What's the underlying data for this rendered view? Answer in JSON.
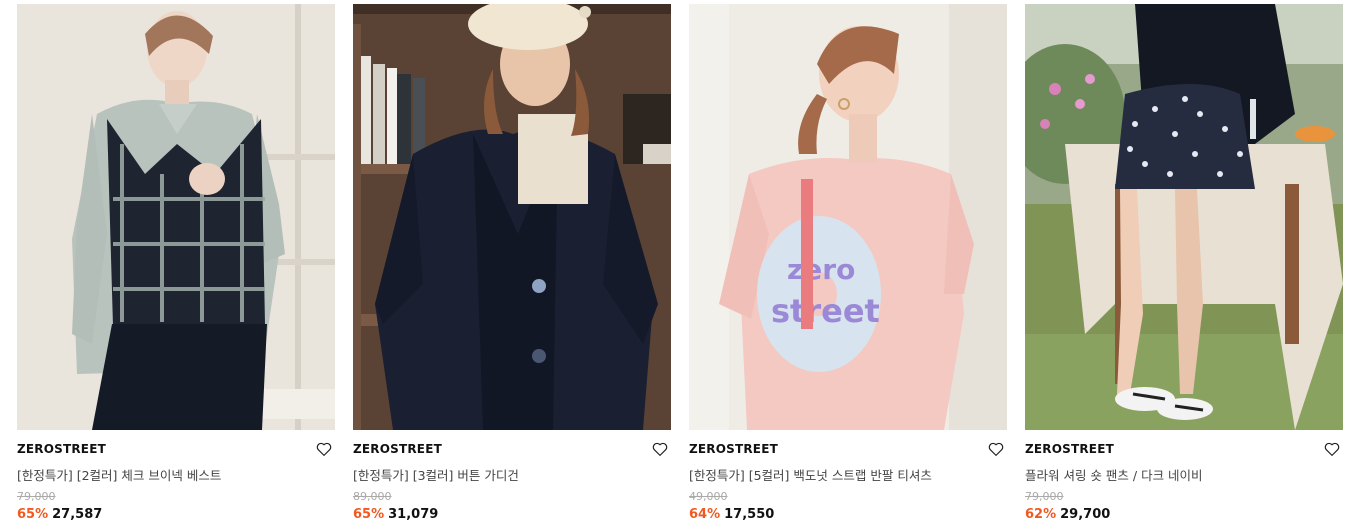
{
  "products": [
    {
      "brand": "ZEROSTREET",
      "title": "[한정특가] [2컬러] 체크 브이넥 베스트",
      "original_price": "79,000",
      "discount": "65%",
      "price": "27,587"
    },
    {
      "brand": "ZEROSTREET",
      "title": "[한정특가] [3컬러] 버튼 가디건",
      "original_price": "89,000",
      "discount": "65%",
      "price": "31,079"
    },
    {
      "brand": "ZEROSTREET",
      "title": "[한정특가] [5컬러] 백도넛 스트랩 반팔 티셔츠",
      "original_price": "49,000",
      "discount": "64%",
      "price": "17,550"
    },
    {
      "brand": "ZEROSTREET",
      "title": "플라워 셔링 숏 팬츠 / 다크 네이비",
      "original_price": "79,000",
      "discount": "62%",
      "price": "29,700"
    }
  ],
  "tshirt_print": "zero street",
  "colors": {
    "discount": "#f05a22",
    "strikethrough": "#aaaaaa"
  },
  "icons": [
    "heart-outline-icon"
  ]
}
